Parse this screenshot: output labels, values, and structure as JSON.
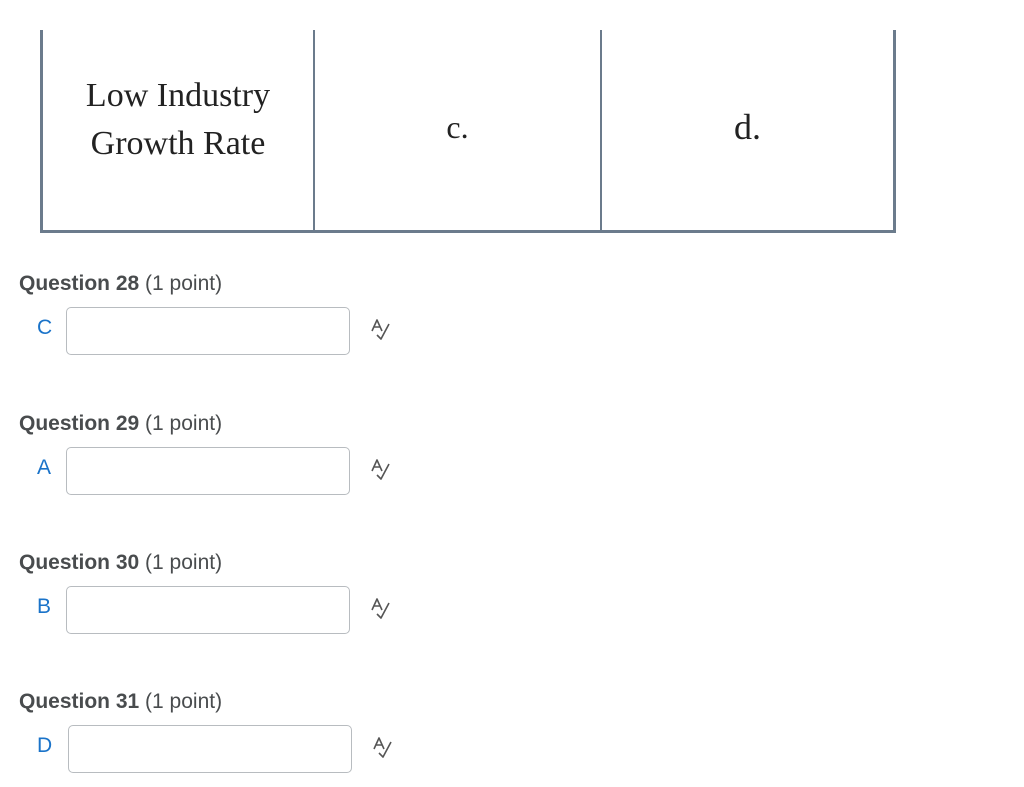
{
  "matrix": {
    "row_header_line1": "Low Industry",
    "row_header_line2": "Growth Rate",
    "col2": "c.",
    "col3": "d."
  },
  "questions": [
    {
      "number": "Question 28",
      "points": "(1 point)",
      "answer_label": "C",
      "input_value": ""
    },
    {
      "number": "Question 29",
      "points": "(1 point)",
      "answer_label": "A",
      "input_value": ""
    },
    {
      "number": "Question 30",
      "points": "(1 point)",
      "answer_label": "B",
      "input_value": ""
    },
    {
      "number": "Question 31",
      "points": "(1 point)",
      "answer_label": "D",
      "input_value": ""
    }
  ],
  "icons": {
    "spell_check": "spell-check-icon"
  },
  "colors": {
    "answer_letter": "#1a73c9",
    "heading_text": "#494c4e",
    "table_border": "#6b7b8c"
  }
}
